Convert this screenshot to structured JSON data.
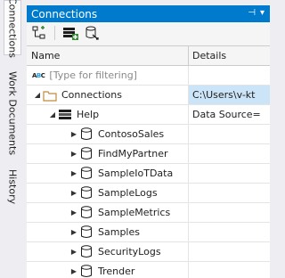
{
  "side_tabs": [
    "Connections",
    "Work Documents",
    "History"
  ],
  "panel": {
    "title": "Connections",
    "title_icons": [
      "⊣",
      "▾"
    ]
  },
  "toolbar": {
    "buttons": [
      "add-connection-icon",
      "add-database-icon",
      "refresh-icon"
    ]
  },
  "grid": {
    "columns": [
      "Name",
      "Details"
    ],
    "filter_placeholder": "[Type for filtering]",
    "root": {
      "name": "Connections",
      "details": "C:\\Users\\v-kt"
    },
    "cluster": {
      "name": "Help",
      "details": "Data Source="
    },
    "databases": [
      "ContosoSales",
      "FindMyPartner",
      "SampleIoTData",
      "SampleLogs",
      "SampleMetrics",
      "Samples",
      "SecurityLogs",
      "Trender"
    ]
  },
  "colors": {
    "accent": "#007acc",
    "selection": "#cce4f7",
    "folder": "#dcb67a"
  }
}
